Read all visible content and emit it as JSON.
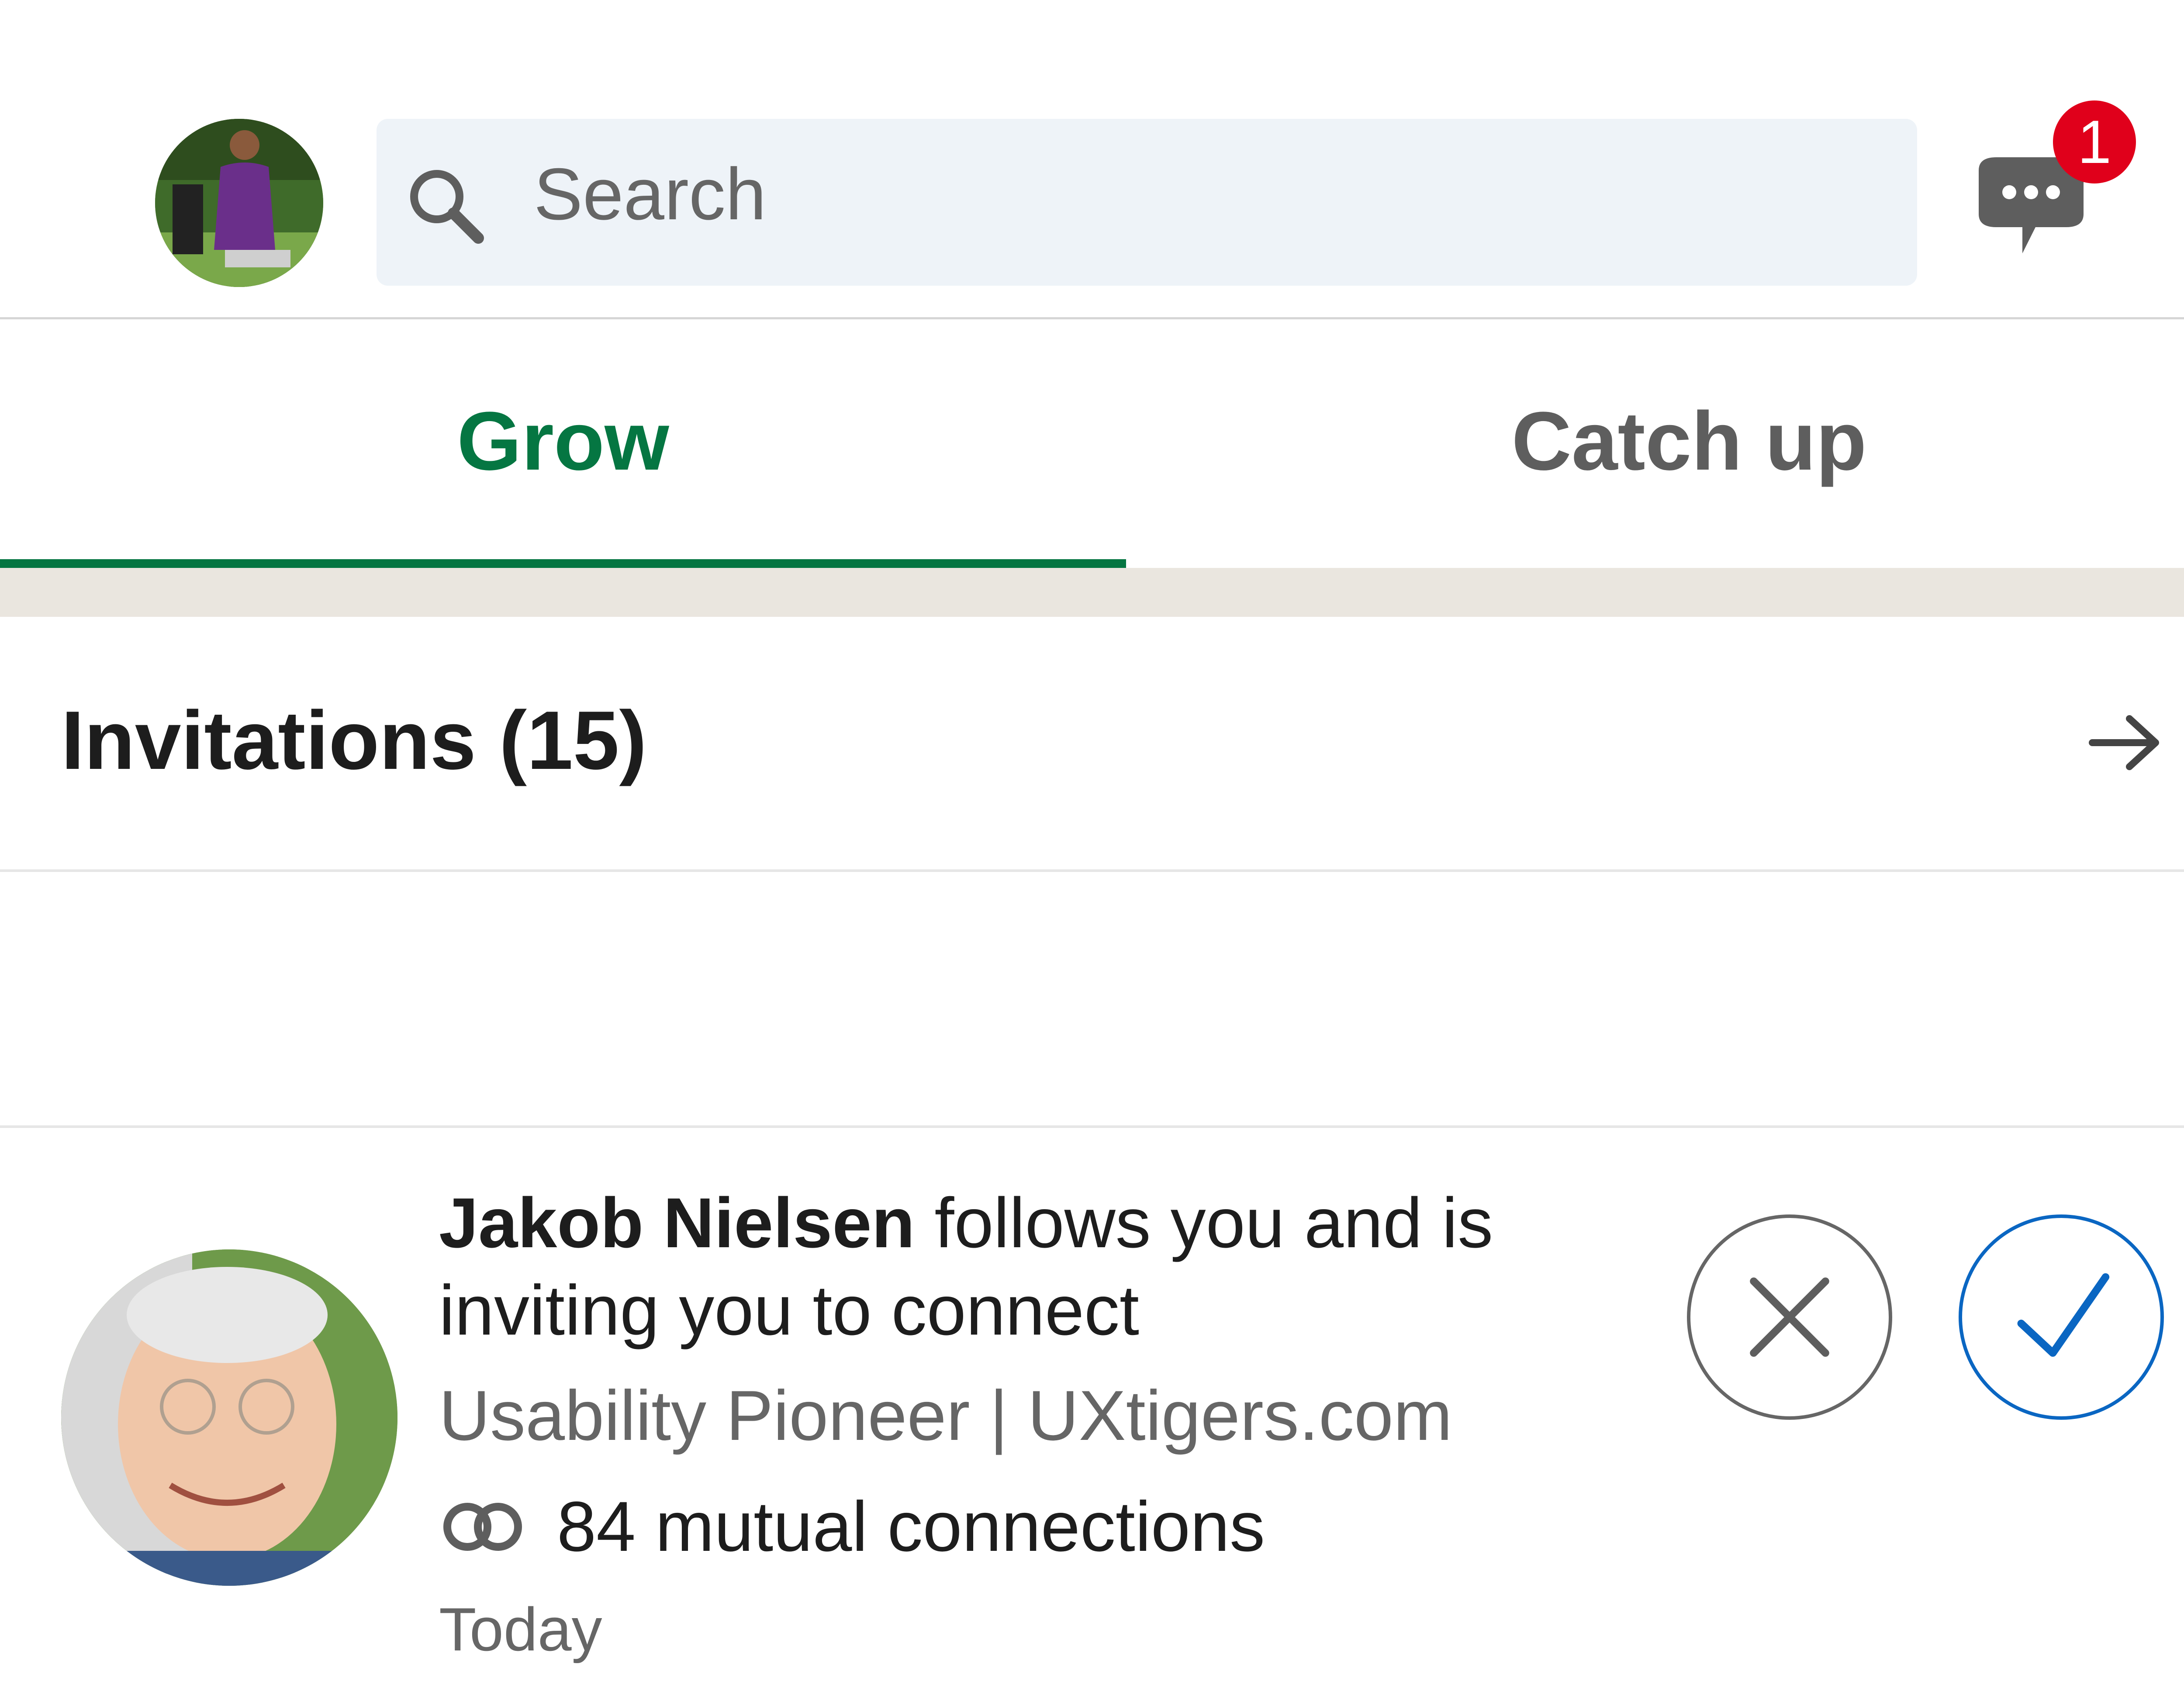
{
  "header": {
    "search_placeholder": "Search",
    "message_badge_count": "1"
  },
  "tabs": [
    {
      "label": "Grow",
      "active": true
    },
    {
      "label": "Catch up",
      "active": false
    }
  ],
  "invitations": {
    "title": "Invitations (15)"
  },
  "invitation": {
    "name": "Jakob Nielsen",
    "message": " follows you and is inviting you to connect",
    "headline": "Usability Pioneer | UXtigers.com",
    "mutual": "84 mutual connections",
    "time": "Today"
  },
  "colors": {
    "accent_green": "#057642",
    "accept_blue": "#0a66c2",
    "badge_red": "#e0001b",
    "search_bg": "#eef3f8",
    "gap_bg": "#eae6df"
  }
}
